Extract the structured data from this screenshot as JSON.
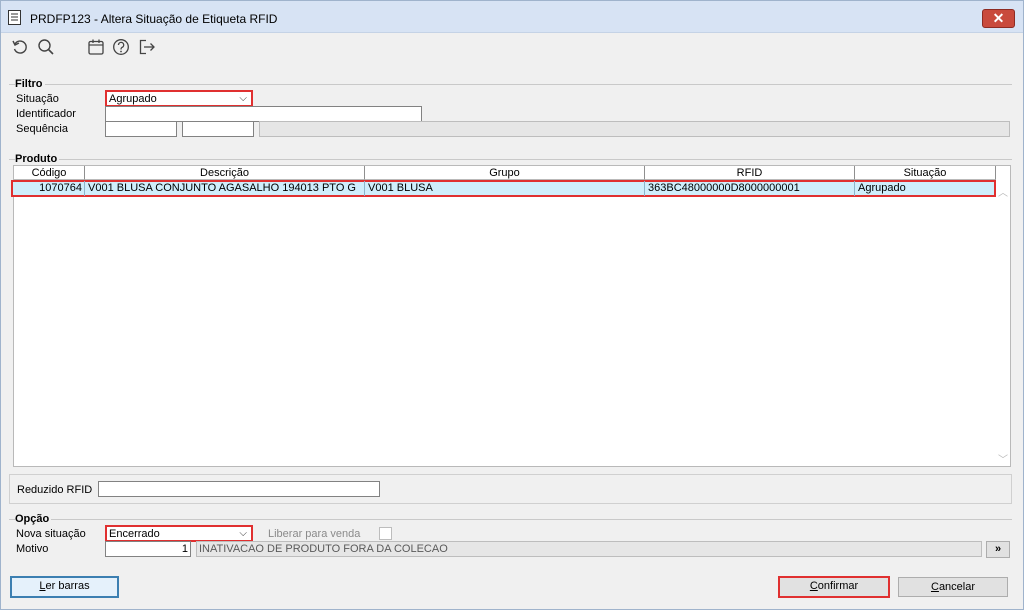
{
  "window": {
    "title": "PRDFP123 - Altera Situação de Etiqueta RFID",
    "close": "✕"
  },
  "toolbar": {
    "icons": [
      "refresh-icon",
      "search-icon",
      "calendar-icon",
      "help-icon",
      "exit-icon"
    ]
  },
  "filtro": {
    "title": "Filtro",
    "situacao_label": "Situação",
    "situacao_value": "Agrupado",
    "identificador_label": "Identificador",
    "identificador_value": "",
    "sequencia_label": "Sequência",
    "sequencia_from": "",
    "sequencia_to": ""
  },
  "produto": {
    "title": "Produto",
    "columns": [
      "Código",
      "Descrição",
      "Grupo",
      "RFID",
      "Situação"
    ],
    "rows": [
      {
        "codigo": "1070764",
        "descricao": "V001 BLUSA CONJUNTO AGASALHO 194013 PTO G",
        "grupo": "V001 BLUSA",
        "rfid": "363BC48000000D8000000001",
        "situacao": "Agrupado"
      }
    ],
    "reduzido_label": "Reduzido RFID",
    "reduzido_value": ""
  },
  "opcao": {
    "title": "Opção",
    "nova_situacao_label": "Nova situação",
    "nova_situacao_value": "Encerrado",
    "liberar_label": "Liberar para venda",
    "motivo_label": "Motivo",
    "motivo_code": "1",
    "motivo_desc": "INATIVACAO DE PRODUTO FORA DA COLECAO",
    "motivo_btn": "»"
  },
  "buttons": {
    "ler_barras_l": "L",
    "ler_barras_rest": "er barras",
    "confirmar_c": "C",
    "confirmar_rest": "onfirmar",
    "cancelar_c": "C",
    "cancelar_rest": "ancelar"
  },
  "colors": {
    "highlight": "#e03030",
    "row_selected": "#cfeefb",
    "titlebar": "#d7e3f4"
  }
}
